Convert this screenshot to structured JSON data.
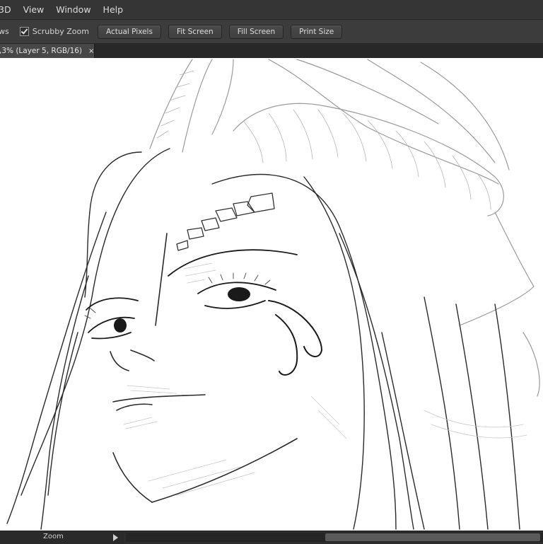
{
  "menu": {
    "items": [
      "3D",
      "View",
      "Window",
      "Help"
    ]
  },
  "options": {
    "partial_label": "ws",
    "scrubby_zoom": {
      "label": "Scrubby Zoom",
      "checked": true
    },
    "buttons": [
      "Actual Pixels",
      "Fit Screen",
      "Fill Screen",
      "Print Size"
    ]
  },
  "document_tab": {
    "title": ",3% (Layer 5, RGB/16)",
    "close": "×"
  },
  "canvas": {
    "content": "line-art sketch of a horned character face"
  },
  "status": {
    "tool_label": "Zoom"
  },
  "colors": {
    "menubar": "#353535",
    "optionsbar": "#3c3c3c",
    "canvas": "#ffffff",
    "sketch_line": "#2a2a2a"
  }
}
